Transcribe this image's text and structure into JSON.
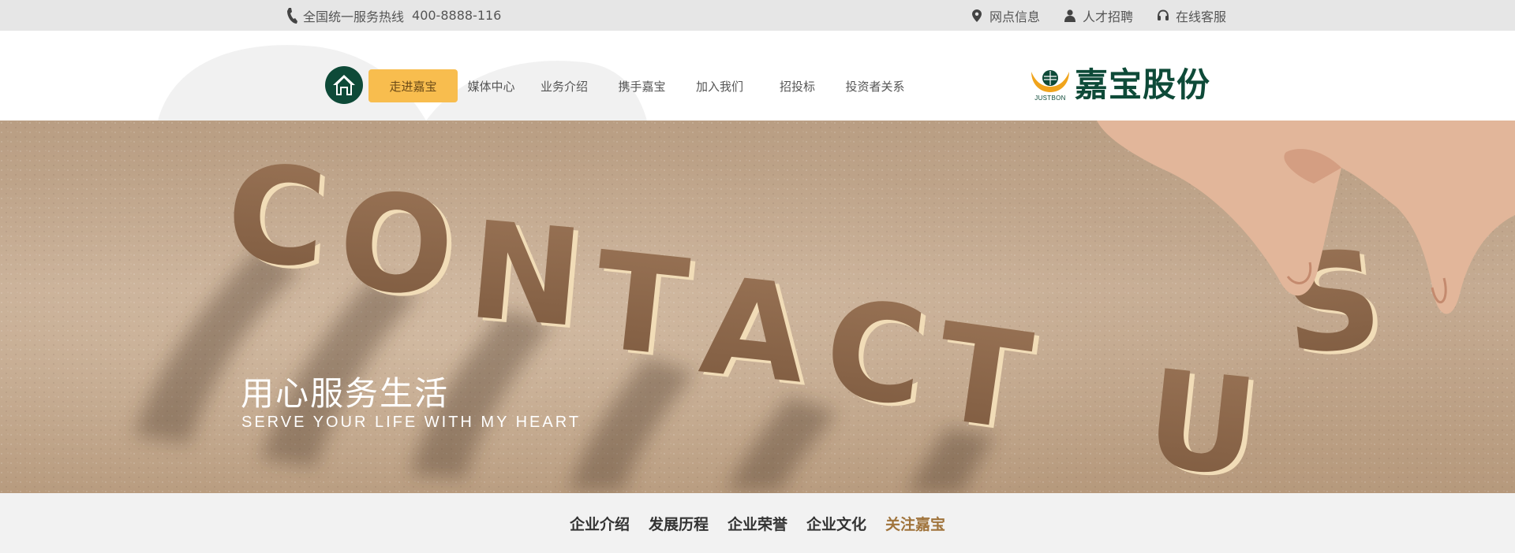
{
  "topbar": {
    "hotline_label": "全国统一服务热线",
    "hotline_number": "400-8888-116",
    "links": [
      {
        "label": "网点信息",
        "icon": "location-pin-icon"
      },
      {
        "label": "人才招聘",
        "icon": "person-icon"
      },
      {
        "label": "在线客服",
        "icon": "headset-icon"
      }
    ]
  },
  "nav": {
    "items": [
      {
        "label": "走进嘉宝",
        "active": true
      },
      {
        "label": "媒体中心"
      },
      {
        "label": "业务介绍"
      },
      {
        "label": "携手嘉宝"
      },
      {
        "label": "加入我们"
      },
      {
        "label": "招投标"
      },
      {
        "label": "投资者关系"
      }
    ]
  },
  "logo": {
    "sub": "JUSTBON",
    "name": "嘉宝股份"
  },
  "banner": {
    "headline": "CONTACT US",
    "slogan_cn": "用心服务生活",
    "slogan_en": "SERVE YOUR LIFE WITH MY HEART"
  },
  "subnav": {
    "items": [
      {
        "label": "企业介绍"
      },
      {
        "label": "发展历程"
      },
      {
        "label": "企业荣誉"
      },
      {
        "label": "企业文化"
      },
      {
        "label": "关注嘉宝",
        "active": true
      }
    ]
  },
  "colors": {
    "brand_green": "#0e4a38",
    "accent_gold": "#f8bd4e",
    "active_brown": "#a0743c",
    "topbar_bg": "#e6e6e6"
  }
}
